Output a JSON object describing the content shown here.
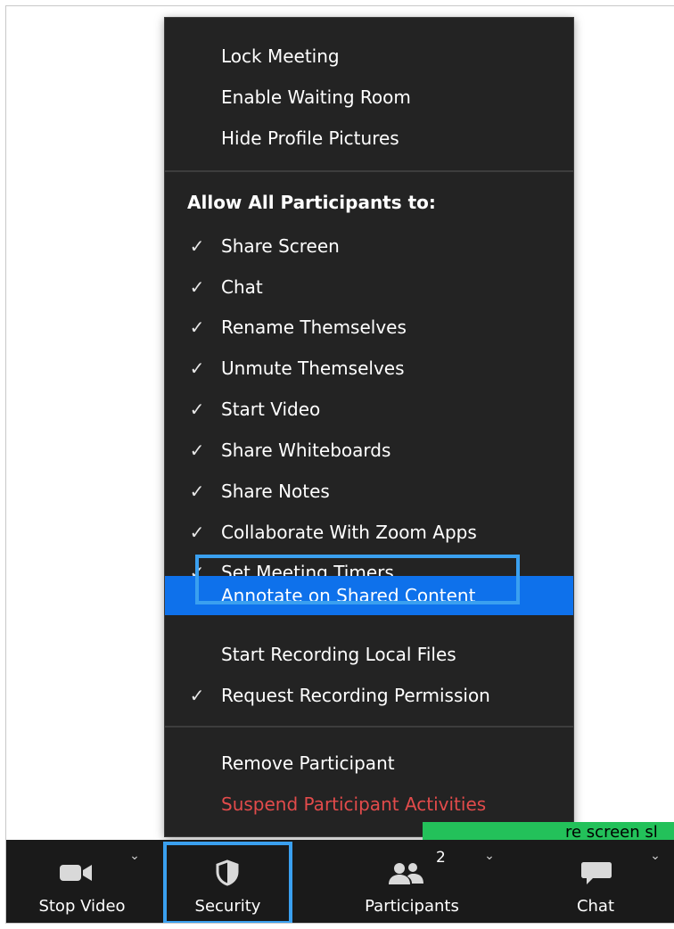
{
  "security_menu": {
    "top_items": [
      {
        "label": "Lock Meeting"
      },
      {
        "label": "Enable Waiting Room"
      },
      {
        "label": "Hide Profile Pictures"
      }
    ],
    "section_heading": "Allow All Participants to:",
    "permissions": [
      {
        "label": "Share Screen",
        "checked": true,
        "check": "✓"
      },
      {
        "label": "Chat",
        "checked": true,
        "check": "✓"
      },
      {
        "label": "Rename Themselves",
        "checked": true,
        "check": "✓"
      },
      {
        "label": "Unmute Themselves",
        "checked": true,
        "check": "✓"
      },
      {
        "label": "Start Video",
        "checked": true,
        "check": "✓"
      },
      {
        "label": "Share Whiteboards",
        "checked": true,
        "check": "✓"
      },
      {
        "label": "Share Notes",
        "checked": true,
        "check": "✓"
      },
      {
        "label": "Collaborate With Zoom Apps",
        "checked": true,
        "check": "✓"
      },
      {
        "label": "Set Meeting Timers",
        "checked": true,
        "check": "✓"
      },
      {
        "label": "Annotate on Shared Content",
        "checked": false,
        "check": "",
        "highlighted": true
      },
      {
        "label": "Start Recording Local Files",
        "checked": false,
        "check": ""
      },
      {
        "label": "Request Recording Permission",
        "checked": true,
        "check": "✓"
      }
    ],
    "bottom_items": [
      {
        "label": "Remove Participant"
      },
      {
        "label": "Suspend Participant Activities",
        "danger": true
      }
    ]
  },
  "share_banner": {
    "text": "re screen sl"
  },
  "toolbar": {
    "stop_video_label": "Stop Video",
    "security_label": "Security",
    "participants_label": "Participants",
    "participants_count": "2",
    "chat_label": "Chat",
    "chevron": "⌄"
  },
  "colors": {
    "menu_bg": "#232323",
    "highlight": "#0e71eb",
    "annotation_outline": "#3aa0f0",
    "danger_text": "#e24b4b",
    "banner_green": "#23c15a",
    "toolbar_bg": "#1a1a1a"
  },
  "icons": {
    "stop_video": "video-camera-icon",
    "security": "shield-icon",
    "participants": "participants-icon",
    "chat": "chat-bubble-icon",
    "checkmark": "checkmark-icon",
    "chevron": "chevron-down-icon"
  }
}
